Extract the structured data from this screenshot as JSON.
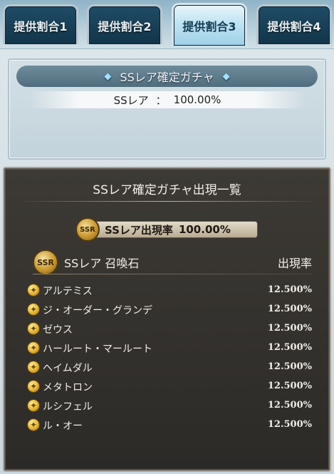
{
  "tabs": [
    {
      "label": "提供割合1",
      "active": false
    },
    {
      "label": "提供割合2",
      "active": false
    },
    {
      "label": "提供割合3",
      "active": true
    },
    {
      "label": "提供割合4",
      "active": false
    }
  ],
  "summary": {
    "title": "SSレア確定ガチャ",
    "rarity_label": "SSレア",
    "separator": "：",
    "rate": "100.00%"
  },
  "detail": {
    "title": "SSレア確定ガチャ出現一覧",
    "total_badge_text": "SSR",
    "total_label": "SSレア出現率",
    "total_rate": "100.00%",
    "header_badge_text": "SSR",
    "category_header": "SSレア 召喚石",
    "rate_header": "出現率",
    "items": [
      {
        "name": "アルテミス",
        "rate": "12.500%"
      },
      {
        "name": "ジ・オーダー・グランデ",
        "rate": "12.500%"
      },
      {
        "name": "ゼウス",
        "rate": "12.500%"
      },
      {
        "name": "ハールート・マールート",
        "rate": "12.500%"
      },
      {
        "name": "ヘイムダル",
        "rate": "12.500%"
      },
      {
        "name": "メタトロン",
        "rate": "12.500%"
      },
      {
        "name": "ルシフェル",
        "rate": "12.500%"
      },
      {
        "name": "ル・オー",
        "rate": "12.500%"
      }
    ]
  },
  "colors": {
    "tab_bg": "#1a4560",
    "tab_active_bg": "#bfe3f2",
    "panel_dark": "#33302c",
    "gold": "#c9972f"
  }
}
